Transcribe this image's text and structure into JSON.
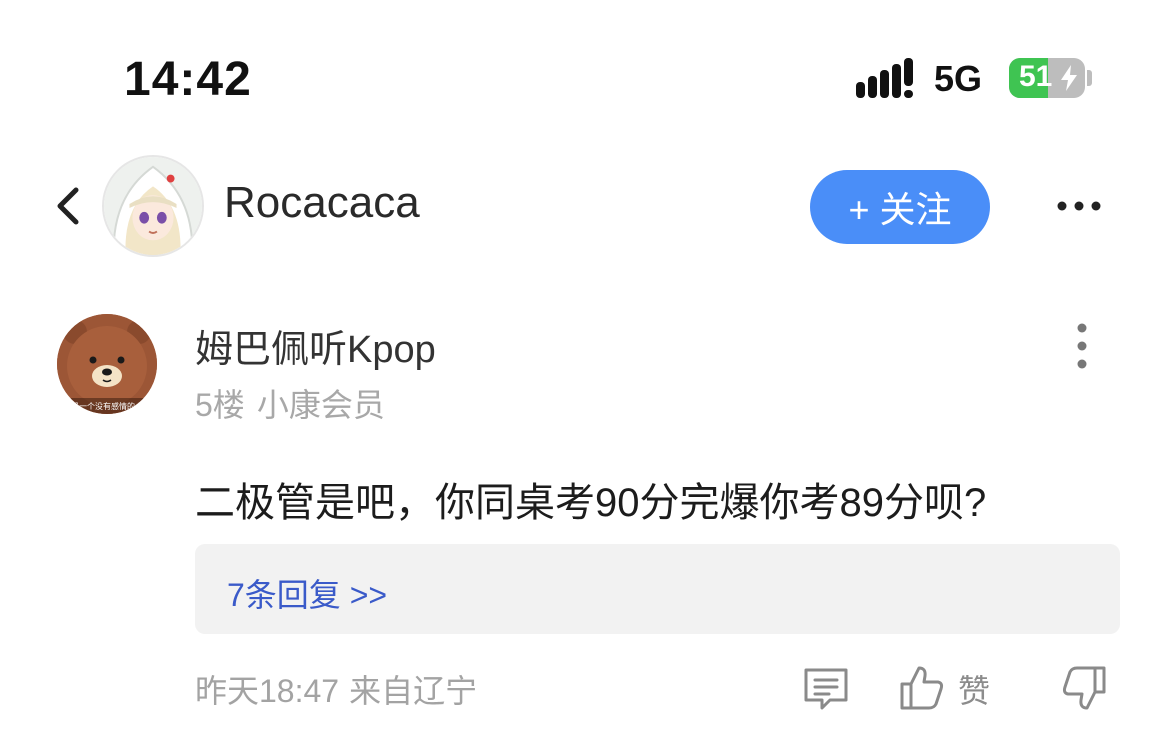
{
  "status_bar": {
    "time": "14:42",
    "network": "5G",
    "battery": "51",
    "battery_level": 0.51,
    "icons": [
      "signal-icon",
      "battery-charging-icon"
    ]
  },
  "header": {
    "back_icon": "chevron-left-icon",
    "username": "Rocacaca",
    "follow_label": "+ 关注",
    "more_icon": "more-horizontal-icon"
  },
  "comment": {
    "author": "姆巴佩听Kpop",
    "floor": "5楼",
    "badge": "小康会员",
    "avatar_caption": "是一个没有感情的会",
    "text": "二极管是吧，你同桌考90分完爆你考89分呗?",
    "replies_link": "7条回复 >>",
    "time": "昨天18:47",
    "location": "来自辽宁",
    "like_label": "赞",
    "action_icons": [
      "reply-icon",
      "thumbs-up-icon",
      "thumbs-down-icon",
      "more-vertical-icon"
    ]
  },
  "colors": {
    "follow_button": "#4a8ef8",
    "link": "#3a5ac9",
    "battery": "#3fc452",
    "muted_text": "#a8a8a8"
  }
}
